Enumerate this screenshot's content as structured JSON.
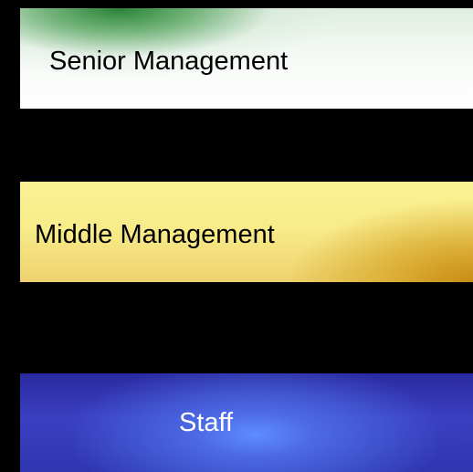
{
  "diagram": {
    "levels": [
      {
        "id": "senior",
        "label": "Senior Management",
        "fill": "#1e7d2d",
        "text_color": "#000000"
      },
      {
        "id": "middle",
        "label": "Middle Management",
        "fill": "#f8ec8a",
        "text_color": "#000000"
      },
      {
        "id": "staff",
        "label": "Staff",
        "fill": "#3a3fc0",
        "text_color": "#ffffff"
      }
    ],
    "background": "#000000"
  }
}
